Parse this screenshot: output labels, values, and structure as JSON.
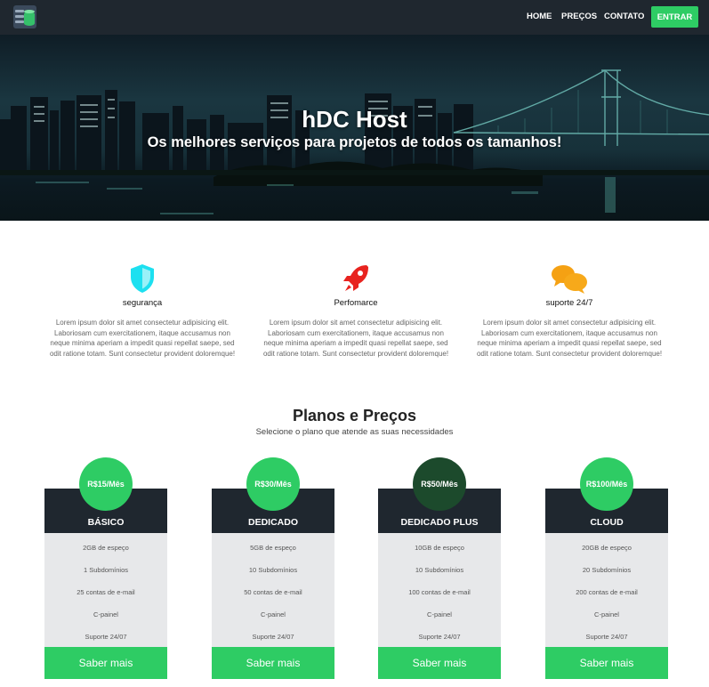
{
  "nav": {
    "links": [
      "HOME",
      "PREÇOS",
      "CONTATO"
    ],
    "cta": "ENTRAR"
  },
  "hero": {
    "title": "hDC Host",
    "subtitle": "Os melhores serviços para projetos de todos os tamanhos!"
  },
  "features": [
    {
      "icon": "shield-icon",
      "title": "segurança",
      "text": "Lorem ipsum dolor sit amet consectetur adipisicing elit. Laboriosam cum exercitationem, itaque accusamus non neque minima aperiam a impedit quasi repellat saepe, sed odit ratione totam. Sunt consectetur provident doloremque!"
    },
    {
      "icon": "rocket-icon",
      "title": "Perfomarce",
      "text": "Lorem ipsum dolor sit amet consectetur adipisicing elit. Laboriosam cum exercitationem, itaque accusamus non neque minima aperiam a impedit quasi repellat saepe, sed odit ratione totam. Sunt consectetur provident doloremque!"
    },
    {
      "icon": "chat-bubbles-icon",
      "title": "suporte 24/7",
      "text": "Lorem ipsum dolor sit amet consectetur adipisicing elit. Laboriosam cum exercitationem, itaque accusamus non neque minima aperiam a impedit quasi repellat saepe, sed odit ratione totam. Sunt consectetur provident doloremque!"
    }
  ],
  "plans_section": {
    "title": "Planos e Preços",
    "subtitle": "Selecione o plano que atende as suas necessidades"
  },
  "plans": [
    {
      "price": "R$15/Mês",
      "name": "BÁSICO",
      "features": [
        "2GB de espeço",
        "1 Subdomínios",
        "25 contas de e-mail",
        "C-painel",
        "Suporte 24/07"
      ],
      "cta": "Saber mais"
    },
    {
      "price": "R$30/Mês",
      "name": "DEDICADO",
      "features": [
        "5GB de espeço",
        "10 Subdomínios",
        "50 contas de e-mail",
        "C-painel",
        "Suporte 24/07"
      ],
      "cta": "Saber mais"
    },
    {
      "price": "R$50/Mês",
      "name": "DEDICADO PLUS",
      "features": [
        "10GB de espeço",
        "10 Subdomínios",
        "100 contas de e-mail",
        "C-painel",
        "Suporte 24/07"
      ],
      "cta": "Saber mais"
    },
    {
      "price": "R$100/Mês",
      "name": "CLOUD",
      "features": [
        "20GB de espeço",
        "20 Subdomínios",
        "200 contas de e-mail",
        "C-painel",
        "Suporte 24/07"
      ],
      "cta": "Saber mais"
    }
  ],
  "colors": {
    "nav_bg": "#1f272f",
    "accent_green": "#2ecc64",
    "featured_price": "#1c4a2c",
    "shield": "#1de0f0",
    "rocket": "#e8231f",
    "chat": "#f5a113"
  }
}
